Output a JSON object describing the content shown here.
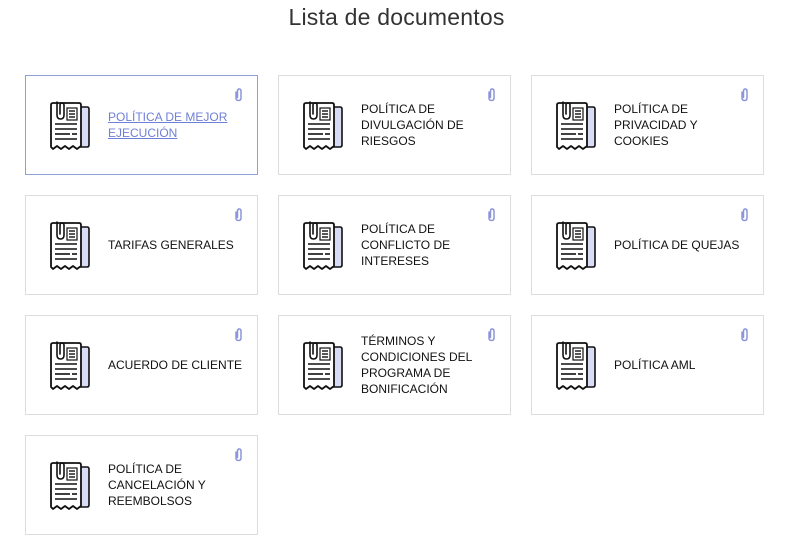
{
  "page": {
    "title": "Lista de documentos"
  },
  "documents": [
    {
      "label": "POLÍTICA DE MEJOR EJECUCIÓN",
      "active": true
    },
    {
      "label": "POLÍTICA DE DIVULGACIÓN DE RIESGOS",
      "active": false
    },
    {
      "label": "POLÍTICA DE PRIVACIDAD Y COOKIES",
      "active": false
    },
    {
      "label": "TARIFAS GENERALES",
      "active": false
    },
    {
      "label": "POLÍTICA DE CONFLICTO DE INTERESES",
      "active": false
    },
    {
      "label": "POLÍTICA DE QUEJAS",
      "active": false
    },
    {
      "label": "ACUERDO DE CLIENTE",
      "active": false
    },
    {
      "label": "TÉRMINOS Y CONDICIONES DEL PROGRAMA DE BONIFICACIÓN",
      "active": false
    },
    {
      "label": "POLÍTICA AML",
      "active": false
    },
    {
      "label": "POLÍTICA DE CANCELACIÓN Y REEMBOLSOS",
      "active": false
    }
  ],
  "icons": {
    "document": "document-icon",
    "attachment": "paperclip-icon"
  },
  "colors": {
    "active_link": "#6f7fd6",
    "active_border": "#8ea0d6",
    "clip": "#8d96d8",
    "icon_fill": "#d9dcf5",
    "card_border": "#dddddd"
  }
}
